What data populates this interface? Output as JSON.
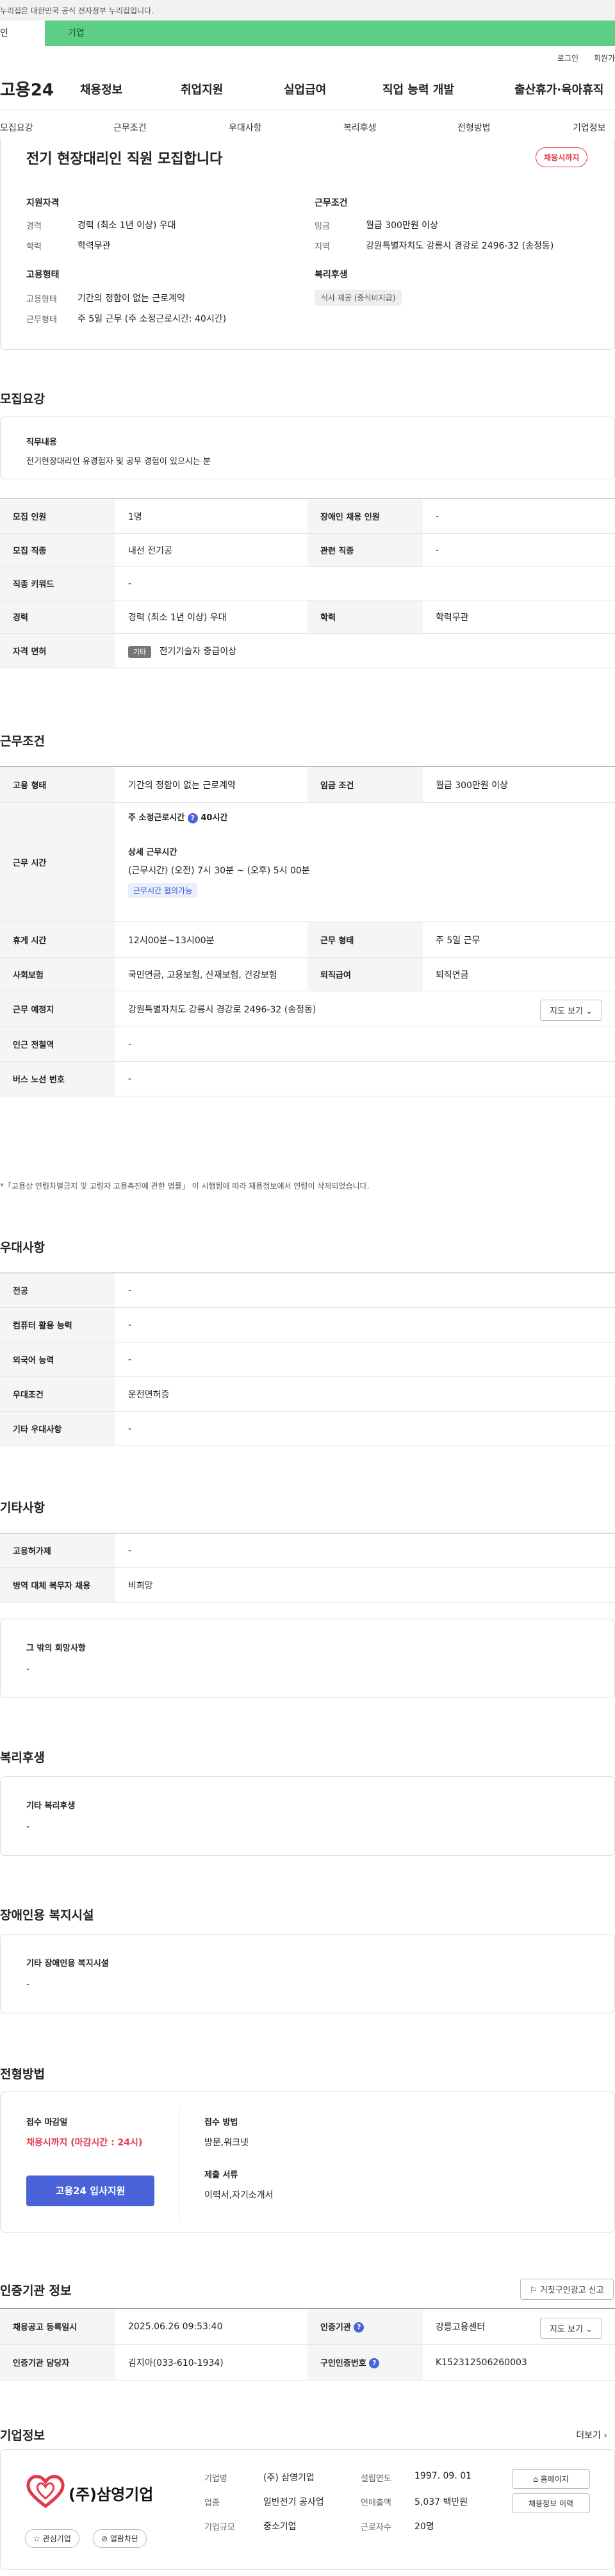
{
  "topbar": {
    "notice": "누리집은 대한민국 공식 전자정부 누리집입니다."
  },
  "tabs": {
    "personal": "인",
    "business": "기업"
  },
  "util": {
    "login": "로그인",
    "signup": "회원가"
  },
  "gnb": {
    "logo": "고용24",
    "menu": [
      "채용정보",
      "취업지원",
      "실업급여",
      "직업 능력 개발",
      "출산휴가·육아휴직"
    ]
  },
  "subnav": [
    "모집요강",
    "근무조건",
    "우대사항",
    "복리후생",
    "전형방법",
    "기업정보"
  ],
  "header": {
    "title": "전기 현장대리인 직원 모집합니다",
    "badge": "채용시까지",
    "qual_title": "지원자격",
    "career_k": "경력",
    "career_v": "경력 (최소 1년 이상) 우대",
    "edu_k": "학력",
    "edu_v": "학력무관",
    "cond_title": "근무조건",
    "wage_k": "임금",
    "wage_v": "월급 300만원 이상",
    "area_k": "지역",
    "area_v": "강원특별자치도 강릉시 경강로 2496-32 (송정동)",
    "emp_title": "고용형태",
    "emptype_k": "고용형태",
    "emptype_v": "기간의 정함이 없는 근로계약",
    "shape_k": "근무형태",
    "shape_v": "주 5일 근무 (주 소정근로시간: 40시간)",
    "welfare_title": "복리후생",
    "welfare_pill": "식사 제공 (중식비지급)"
  },
  "recruit": {
    "h": "모집요강",
    "job_desc_k": "직무내용",
    "job_desc_v": "전기현장대리인 유경험자 및 공무 경험이 있으시는 분",
    "rows": {
      "count_k": "모집 인원",
      "count_v": "1명",
      "disabled_k": "장애인 채용 인원",
      "disabled_v": "-",
      "job_k": "모집 직종",
      "job_v": "내선 전기공",
      "rel_k": "관련 직종",
      "rel_v": "-",
      "kw_k": "직종 키워드",
      "kw_v": "-",
      "career_k": "경력",
      "career_v": "경력 (최소 1년 이상) 우대",
      "edu_k": "학력",
      "edu_v": "학력무관",
      "lic_k": "자격 면허",
      "lic_tag": "기타",
      "lic_v": "전기기술자 중급이상"
    }
  },
  "conditions": {
    "h": "근무조건",
    "emptype_k": "고용 형태",
    "emptype_v": "기간의 정함이 없는 근로계약",
    "wage_k": "임금 조건",
    "wage_v": "월급 300만원 이상",
    "hours_k": "근무 시간",
    "hours_week_label": "주 소정근로시간",
    "hours_week_v": "40시간",
    "hours_detail_label": "상세 근무시간",
    "hours_detail_v": "(근무시간) (오전) 7시 30분 ~ (오후) 5시 00분",
    "hours_tag": "근무시간 협의가능",
    "break_k": "휴게 시간",
    "break_v": "12시00분~13시00분",
    "shape_k": "근무 형태",
    "shape_v": "주 5일 근무",
    "ins_k": "사회보험",
    "ins_v": "국민연금, 고용보험, 산재보험, 건강보험",
    "ret_k": "퇴직급여",
    "ret_v": "퇴직연금",
    "place_k": "근무 예정지",
    "place_v": "강원특별자치도 강릉시 경강로 2496-32 (송정동)",
    "map_btn": "지도 보기",
    "subway_k": "인근 전철역",
    "subway_v": "-",
    "bus_k": "버스 노선 번호",
    "bus_v": "-",
    "note": "*「고용상 연령차별금지 및 고령자 고용촉진에 관한 법률」 이 시행됨에 따라 채용정보에서 연령이 삭제되었습니다."
  },
  "prefer": {
    "h": "우대사항",
    "major_k": "전공",
    "major_v": "-",
    "pc_k": "컴퓨터 활용 능력",
    "pc_v": "-",
    "lang_k": "외국어 능력",
    "lang_v": "-",
    "cond_k": "우대조건",
    "cond_v": "운전면허증",
    "etc_k": "기타 우대사항",
    "etc_v": "-"
  },
  "etc": {
    "h": "기타사항",
    "permit_k": "고용허가제",
    "permit_v": "-",
    "military_k": "병역 대체 복무자 채용",
    "military_v": "비희망",
    "wish_k": "그 밖의 희망사항",
    "wish_v": "-"
  },
  "welfare": {
    "h": "복리후생",
    "k": "기타 복리후생",
    "v": "-"
  },
  "disabled": {
    "h": "장애인용 복지시설",
    "k": "기타 장애인용 복지시설",
    "v": "-"
  },
  "selection": {
    "h": "전형방법",
    "deadline_k": "접수 마감일",
    "deadline_v": "채용시까지 (마감시간 : 24시)",
    "apply_btn": "고용24 입사지원",
    "method_k": "접수 방법",
    "method_v": "방문,워크넷",
    "docs_k": "제출 서류",
    "docs_v": "이력서,자기소개서"
  },
  "agency": {
    "h": "인증기관 정보",
    "report_btn": "거짓구인광고 신고",
    "reg_k": "채용공고 등록일시",
    "reg_v": "2025.06.26 09:53:40",
    "inst_k": "인증기관",
    "inst_v": "강릉고용센터",
    "map_btn": "지도 보기",
    "mgr_k": "인증기관 담당자",
    "mgr_v": "김지아(033-610-1934)",
    "no_k": "구인인증번호",
    "no_v": "K152312506260003"
  },
  "company": {
    "h": "기업정보",
    "more": "더보기",
    "logo_text": "(주)삼영기업",
    "fav_btn": "관심기업",
    "block_btn": "열람차단",
    "name_k": "기업명",
    "name_v": "(주) 삼영기업",
    "found_k": "설립연도",
    "found_v": "1997. 09. 01",
    "ind_k": "업종",
    "ind_v": "일반전기 공사업",
    "sales_k": "연매출액",
    "sales_v": "5,037 백만원",
    "size_k": "기업규모",
    "size_v": "중소기업",
    "emp_k": "근로자수",
    "emp_v": "20명",
    "home_btn": "홈페이지",
    "history_btn": "채용정보 이력"
  },
  "colors": {
    "accent": "#4a63d8",
    "red": "#e23a4c",
    "green": "#5ccf85"
  }
}
